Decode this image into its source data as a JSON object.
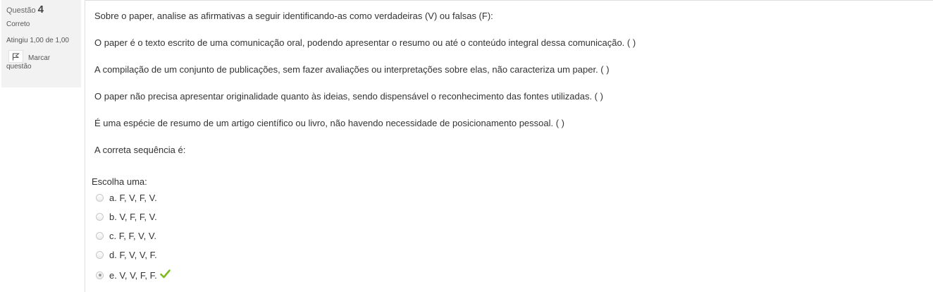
{
  "question_info": {
    "label": "Questão",
    "number": "4",
    "state": "Correto",
    "grade": "Atingiu 1,00 de 1,00",
    "flag_line1": "Marcar",
    "flag_line2": "questão"
  },
  "question": {
    "intro": "Sobre o paper, analise as afirmativas a seguir identificando-as como verdadeiras (V) ou falsas (F):",
    "statements": [
      "O paper é o texto escrito de uma comunicação oral, podendo apresentar o resumo ou até o conteúdo integral dessa comunicação. ( )",
      "A compilação de um conjunto de publicações, sem fazer avaliações ou interpretações sobre elas, não caracteriza um paper. ( )",
      "O paper não precisa apresentar originalidade quanto às ideias, sendo dispensável o reconhecimento das fontes utilizadas. ( )",
      "É uma espécie de resumo de um artigo científico ou livro, não havendo necessidade de posicionamento pessoal. ( )"
    ],
    "closing": "A correta sequência é:",
    "prompt": "Escolha uma:",
    "options": [
      {
        "label": "a. F, V, F, V.",
        "selected": false
      },
      {
        "label": "b. V, F, F, V.",
        "selected": false
      },
      {
        "label": "c. F, F, V, V.",
        "selected": false
      },
      {
        "label": "d. F, V, V, F.",
        "selected": false
      },
      {
        "label": "e. V, V, F, F.",
        "selected": true,
        "correct": true
      }
    ]
  },
  "icons": {
    "flag": "flag-icon",
    "correct": "checkmark-icon"
  },
  "colors": {
    "info_bg": "#f2f2f2",
    "correct_check": "#7cbc1f"
  }
}
